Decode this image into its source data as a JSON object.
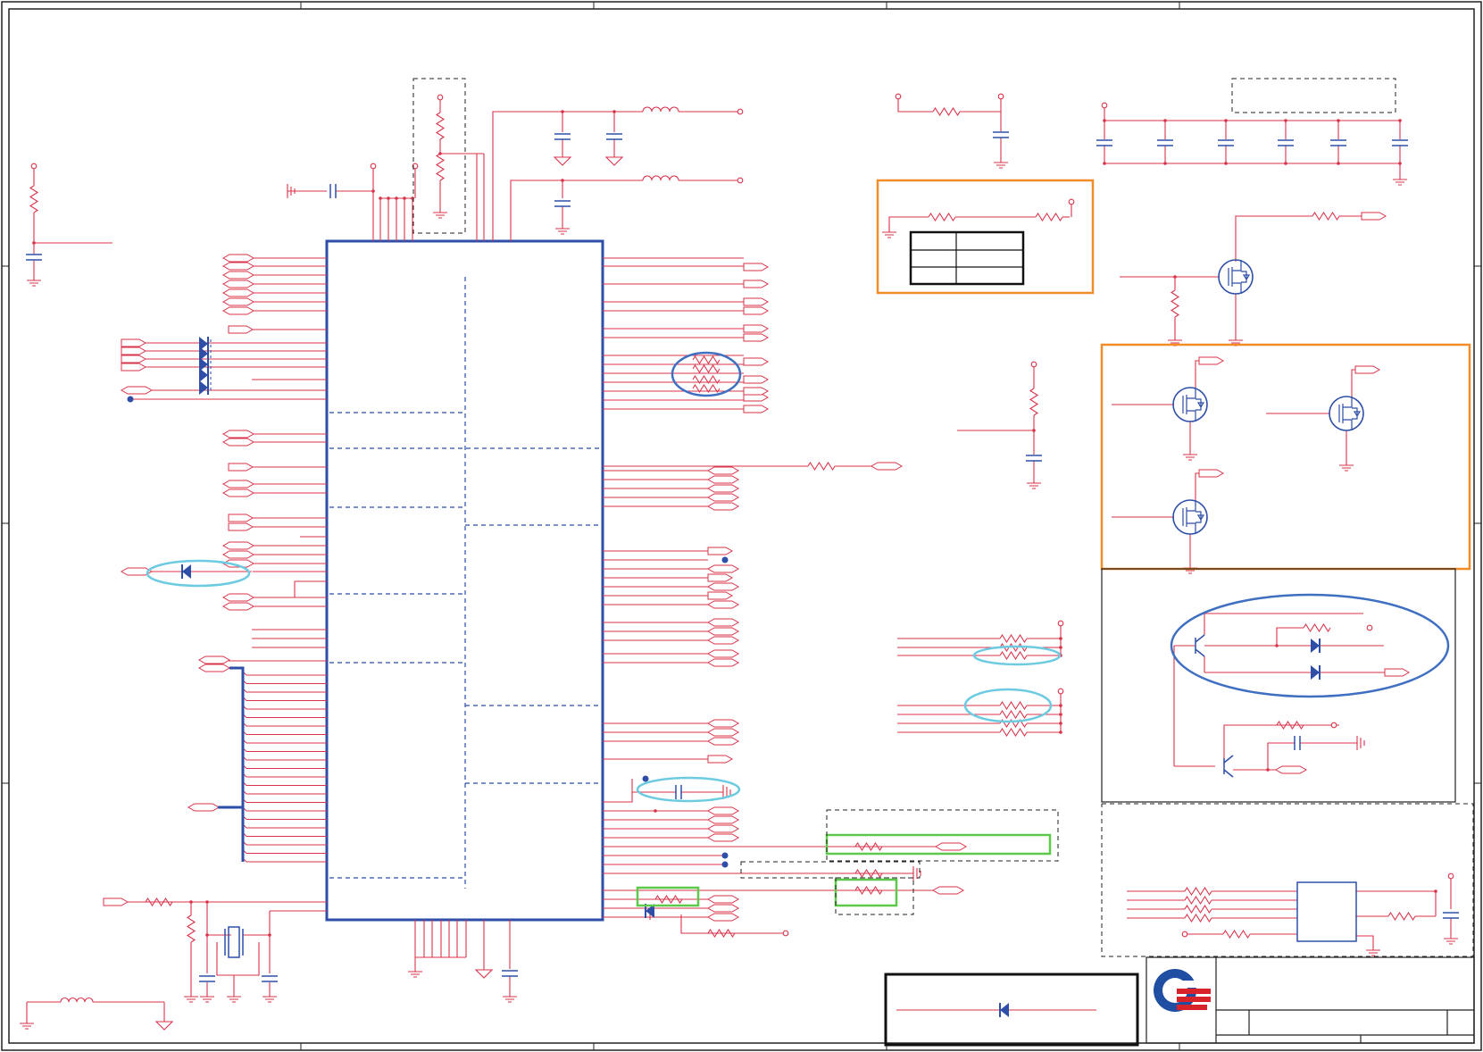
{
  "colors": {
    "wire": "#d8334a",
    "ic": "#2e4ea8",
    "component": "#2e4ea8",
    "highlight_orange": "#f28c28",
    "highlight_green": "#5cc94b",
    "highlight_cyan": "#6ccbe0",
    "highlight_blue": "#3f6fc1",
    "frame": "#222222",
    "dashed": "#2e4ea8",
    "logo_blue": "#1f4ea3",
    "logo_red": "#d8232a"
  },
  "icons": [
    "company-logo"
  ]
}
